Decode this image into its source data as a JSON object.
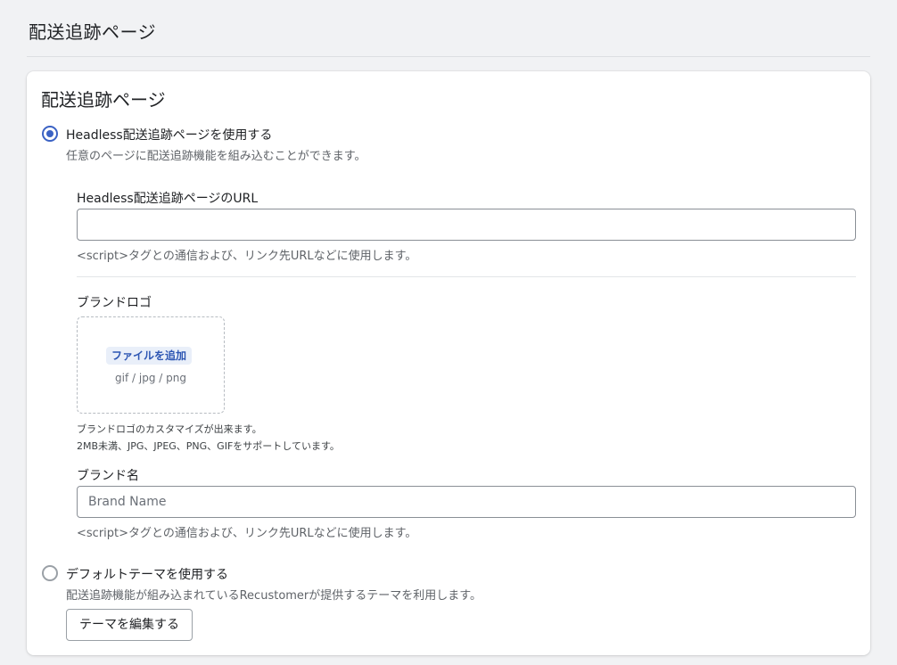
{
  "page": {
    "title": "配送追跡ページ"
  },
  "card": {
    "title": "配送追跡ページ",
    "headless_option": {
      "label": "Headless配送追跡ページを使用する",
      "description": "任意のページに配送追跡機能を組み込むことができます。",
      "selected": true,
      "url_field": {
        "label": "Headless配送追跡ページのURL",
        "value": "",
        "placeholder": "",
        "help": "<script>タグとの通信および、リンク先URLなどに使用します。"
      },
      "brand_logo": {
        "label": "ブランドロゴ",
        "upload_button": "ファイルを追加",
        "file_types": "gif / jpg / png",
        "note_line1": "ブランドロゴのカスタマイズが出来ます。",
        "note_line2": "2MB未満、JPG、JPEG、PNG、GIFをサポートしています。"
      },
      "brand_name": {
        "label": "ブランド名",
        "value": "",
        "placeholder": "Brand Name",
        "help": "<script>タグとの通信および、リンク先URLなどに使用します。"
      }
    },
    "default_option": {
      "label": "デフォルトテーマを使用する",
      "description": "配送追跡機能が組み込まれているRecustomerが提供するテーマを利用します。",
      "selected": false,
      "edit_button": "テーマを編集する"
    }
  },
  "colors": {
    "accent": "#3b62c4",
    "upload_button_bg": "#e9eff9",
    "upload_button_text": "#2d56b3"
  }
}
